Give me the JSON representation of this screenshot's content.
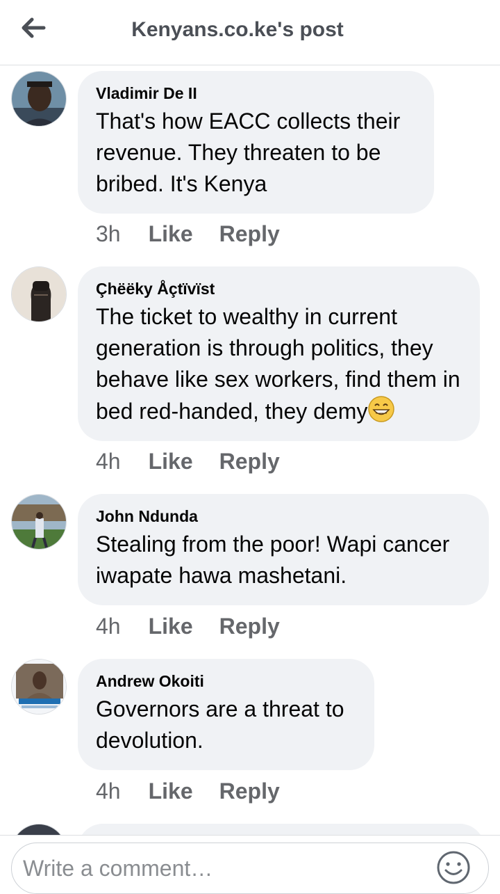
{
  "header": {
    "title": "Kenyans.co.ke's post",
    "back_icon": "back-arrow-icon"
  },
  "comments": [
    {
      "author": "Vladimir De II",
      "text": "That's how EACC collects their revenue. They threaten to be bribed. It's Kenya",
      "time": "3h",
      "like_label": "Like",
      "reply_label": "Reply"
    },
    {
      "author": "Çhëëky Åçtïvïst",
      "text": "The ticket to wealthy in current generation is through politics, they behave like  sex workers, find them in bed red-handed, they demy",
      "emoji": "grinning-face-icon",
      "time": "4h",
      "like_label": "Like",
      "reply_label": "Reply"
    },
    {
      "author": "John Ndunda",
      "text": "Stealing from the poor! Wapi cancer iwapate hawa mashetani.",
      "time": "4h",
      "like_label": "Like",
      "reply_label": "Reply"
    },
    {
      "author": "Andrew Okoiti",
      "text": "Governors are a threat to devolution.",
      "time": "4h",
      "like_label": "Like",
      "reply_label": "Reply"
    }
  ],
  "composer": {
    "placeholder": "Write a comment…",
    "emoji_icon": "smiley-icon"
  },
  "colors": {
    "bubble": "#f0f2f5",
    "meta_text": "#65676b",
    "header_title": "#4b4f56"
  }
}
